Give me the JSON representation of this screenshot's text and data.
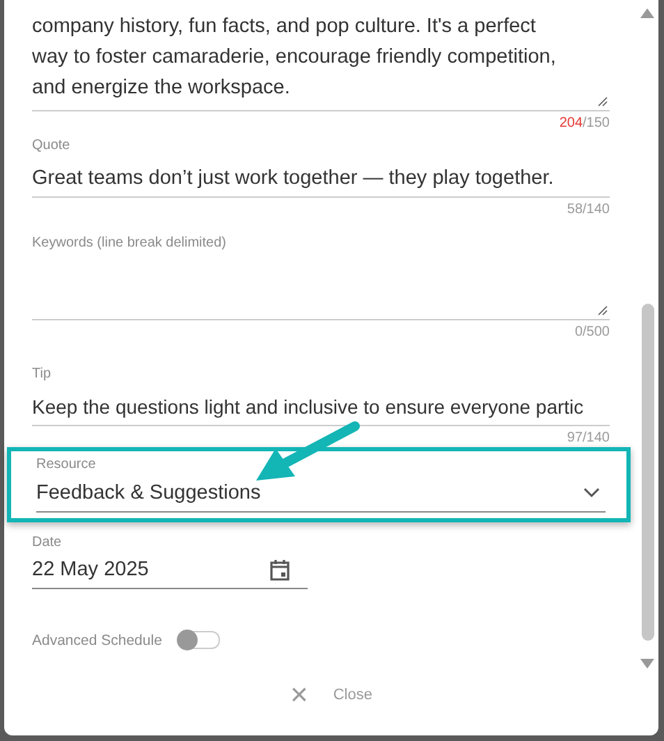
{
  "fields": [
    {
      "kind": "textarea",
      "value": "company history, fun facts, and pop culture. It's a perfect way to foster camaraderie, encourage friendly competition, and energize the workspace.",
      "count": "204",
      "limit": "/150",
      "over_limit": true
    },
    {
      "kind": "text",
      "label": "Quote",
      "value": "Great teams don’t just work together — they play together.",
      "count": "58",
      "limit": "/140",
      "over_limit": false
    },
    {
      "kind": "textarea",
      "label": "Keywords (line break delimited)",
      "count": "0",
      "limit": "/500",
      "over_limit": false
    },
    {
      "kind": "text",
      "label": "Tip",
      "value": "Keep the questions light and inclusive to ensure everyone partic",
      "count": "97",
      "limit": "/140",
      "over_limit": false
    },
    {
      "kind": "select",
      "label": "Resource",
      "value": "Feedback & Suggestions",
      "highlighted": true
    },
    {
      "kind": "date",
      "label": "Date",
      "value": "22 May 2025"
    },
    {
      "kind": "toggle",
      "label": "Advanced Schedule",
      "on": false
    }
  ],
  "close_button": {
    "icon": "×",
    "label": "Close"
  }
}
